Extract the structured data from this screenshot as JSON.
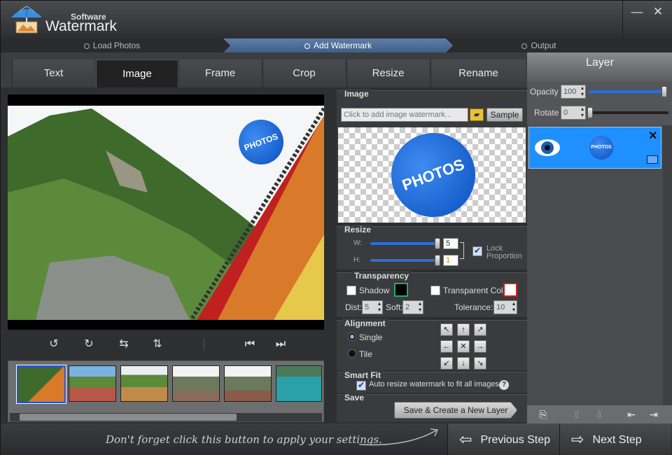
{
  "window": {
    "app_name_small": "Software",
    "app_name": "Watermark",
    "minimize": "—",
    "close": "✕"
  },
  "steps": [
    "Load Photos",
    "Add Watermark",
    "Output"
  ],
  "tabs": [
    "Text",
    "Image",
    "Frame",
    "Crop",
    "Resize",
    "Rename"
  ],
  "active_tab": "Image",
  "preview": {
    "badge_text": "PHOTOS"
  },
  "image_section": {
    "title": "Image",
    "input_placeholder": "Click to add image watermark...",
    "sample_button": "Sample",
    "badge_text": "PHOTOS"
  },
  "resize": {
    "title": "Resize",
    "w_label": "W:",
    "w_value": "5",
    "h_label": "H:",
    "h_value": "1",
    "lock_label_1": "Lock",
    "lock_label_2": "Proportion",
    "lock_checked": true
  },
  "transparency": {
    "title": "Transparency",
    "shadow_label": "Shadow",
    "transparent_color_label": "Transparent Color",
    "dist_label": "Dist:",
    "dist_value": "5",
    "soft_label": "Soft:",
    "soft_value": "2",
    "tolerance_label": "Tolerance:",
    "tolerance_value": "10"
  },
  "alignment": {
    "title": "Alignment",
    "single_label": "Single",
    "tile_label": "Tile",
    "selected": "Single"
  },
  "smartfit": {
    "title": "Smart Fit",
    "label": "Auto resize watermark to fit all images.",
    "checked": true,
    "help": "?"
  },
  "save": {
    "title": "Save",
    "button": "Save & Create a New Layer"
  },
  "layer_panel": {
    "title": "Layer",
    "opacity_label": "Opacity",
    "opacity_value": "100",
    "rotate_label": "Rotate",
    "rotate_value": "0",
    "layer_badge": "PHOTOS",
    "layer_close": "✕"
  },
  "footer": {
    "hint": "Don't forget click this button to apply your settings.",
    "previous": "Previous Step",
    "next": "Next Step"
  },
  "colors": {
    "accent": "#2d6ed8",
    "layer_selected": "#1e90ff",
    "step_active": "#4f70a0"
  }
}
